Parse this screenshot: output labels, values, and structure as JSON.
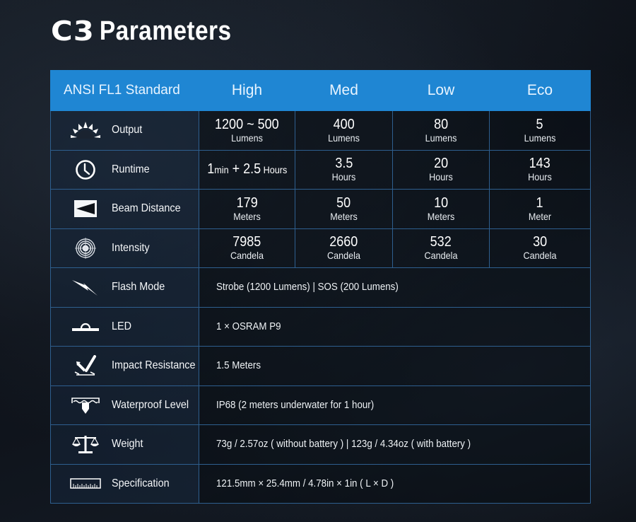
{
  "header": {
    "model": "C3",
    "title": "Parameters"
  },
  "table": {
    "columns": [
      "ANSI FL1  Standard",
      "High",
      "Med",
      "Low",
      "Eco"
    ],
    "mode_rows": [
      {
        "label": "Output",
        "icon": "sunrise-icon",
        "cells": [
          {
            "value": "1200 ~ 500",
            "unit": "Lumens"
          },
          {
            "value": "400",
            "unit": "Lumens"
          },
          {
            "value": "80",
            "unit": "Lumens"
          },
          {
            "value": "5",
            "unit": "Lumens"
          }
        ]
      },
      {
        "label": "Runtime",
        "icon": "clock-icon",
        "cells": [
          {
            "value_a": "1",
            "unit_a": "min",
            "plus": " + ",
            "value_b": "2.5",
            "unit_b": " Hours"
          },
          {
            "value": "3.5",
            "unit": "Hours"
          },
          {
            "value": "20",
            "unit": "Hours"
          },
          {
            "value": "143",
            "unit": "Hours"
          }
        ]
      },
      {
        "label": "Beam Distance",
        "icon": "beam-icon",
        "cells": [
          {
            "value": "179",
            "unit": "Meters"
          },
          {
            "value": "50",
            "unit": "Meters"
          },
          {
            "value": "10",
            "unit": "Meters"
          },
          {
            "value": "1",
            "unit": "Meter"
          }
        ]
      },
      {
        "label": "Intensity",
        "icon": "target-icon",
        "cells": [
          {
            "value": "7985",
            "unit": "Candela"
          },
          {
            "value": "2660",
            "unit": "Candela"
          },
          {
            "value": "532",
            "unit": "Candela"
          },
          {
            "value": "30",
            "unit": "Candela"
          }
        ]
      }
    ],
    "spec_rows": [
      {
        "label": "Flash Mode",
        "icon": "lightning-icon",
        "value": "Strobe (1200 Lumens)  |  SOS (200 Lumens)"
      },
      {
        "label": "LED",
        "icon": "led-icon",
        "value": "1 × OSRAM P9"
      },
      {
        "label": "Impact Resistance",
        "icon": "impact-icon",
        "value": "1.5 Meters"
      },
      {
        "label": "Waterproof Level",
        "icon": "waterproof-icon",
        "value": "IP68  (2 meters underwater for 1 hour)"
      },
      {
        "label": "Weight",
        "icon": "scale-icon",
        "value": "73g / 2.57oz ( without battery )  |  123g / 4.34oz ( with battery )"
      },
      {
        "label": "Specification",
        "icon": "ruler-icon",
        "value": "121.5mm × 25.4mm / 4.78in × 1in ( L × D )"
      }
    ]
  }
}
